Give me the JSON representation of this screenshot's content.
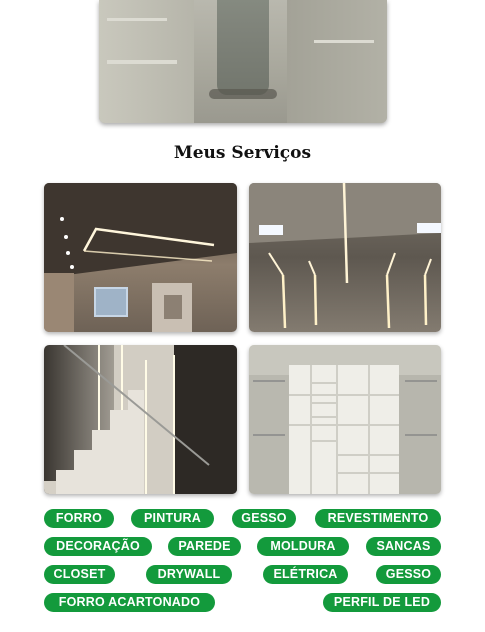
{
  "section": {
    "title": "Meus Serviços"
  },
  "gallery": [
    {
      "name": "ceiling-led-lighting-photo"
    },
    {
      "name": "led-profile-wall-photo"
    },
    {
      "name": "staircase-led-photo"
    },
    {
      "name": "built-in-shelves-photo"
    }
  ],
  "tags": [
    "FORRO",
    "PINTURA",
    "GESSO",
    "REVESTIMENTO",
    "DECORAÇÃO",
    "PAREDE",
    "MOLDURA",
    "SANCAS",
    "CLOSET",
    "DRYWALL",
    "ELÉTRICA",
    "GESSO",
    "FORRO ACARTONADO",
    "PERFIL DE LED"
  ],
  "colors": {
    "tag_bg": "#139a3c",
    "tag_text": "#ffffff"
  }
}
